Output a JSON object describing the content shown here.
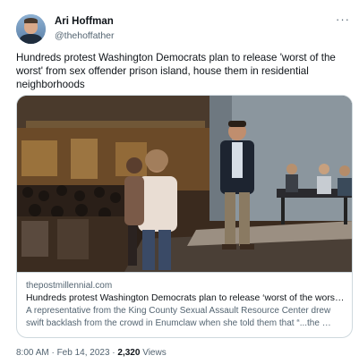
{
  "author": {
    "name": "Ari Hoffman",
    "handle": "@thehoffather"
  },
  "tweet": {
    "text": "Hundreds protest Washington Democrats plan to release 'worst of the worst' from sex offender prison island, house them in residential neighborhoods"
  },
  "card": {
    "domain": "thepostmillennial.com",
    "title": "Hundreds protest Washington Democrats plan to release ‘worst of the worst’…",
    "description": "A representative from the King County Sexual Assault Resource Center drew swift backlash from the crowd in Enumclaw when she told them that “...the …"
  },
  "footer": {
    "timestamp": "8:00 AM · Feb 14, 2023 · ",
    "views_count": "2,320",
    "views_label": " Views"
  },
  "icons": {
    "more": "more-options-icon"
  }
}
